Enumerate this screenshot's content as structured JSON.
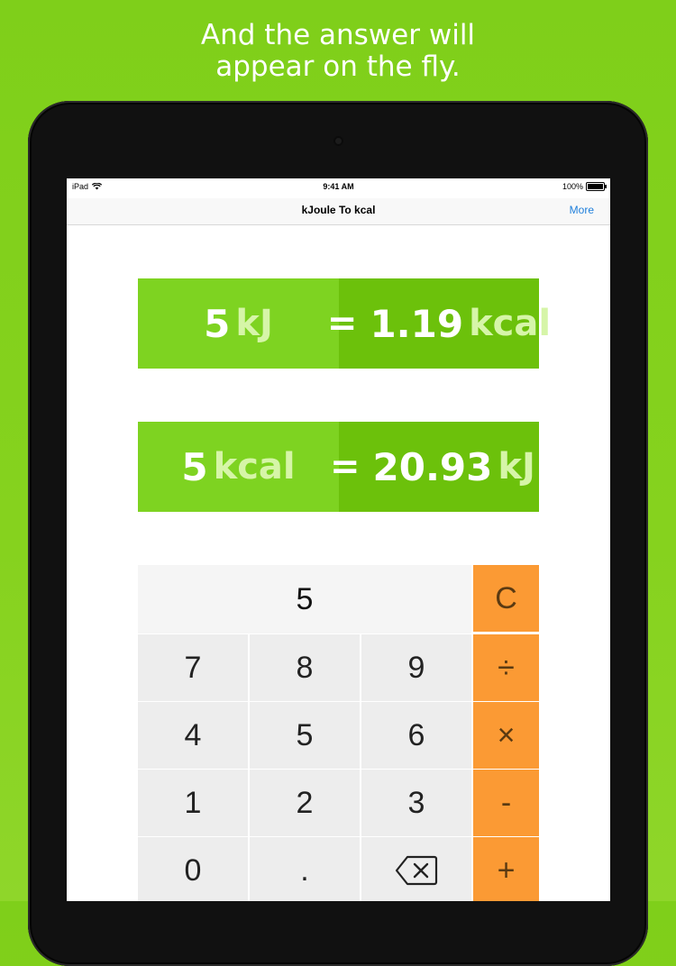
{
  "headline": {
    "line1": "And the answer will",
    "line2": "appear on the fly."
  },
  "status_bar": {
    "device": "iPad",
    "time": "9:41 AM",
    "battery": "100%"
  },
  "nav": {
    "title": "kJoule To kcal",
    "more": "More"
  },
  "conversions": [
    {
      "input_value": "5",
      "input_unit": "kJ",
      "equals": "=",
      "result_value": "1.19",
      "result_unit": "kcal"
    },
    {
      "input_value": "5",
      "input_unit": "kcal",
      "equals": "=",
      "result_value": "20.93",
      "result_unit": "kJ"
    }
  ],
  "keypad": {
    "display_value": "5",
    "clear": "C",
    "row1": [
      "7",
      "8",
      "9"
    ],
    "row2": [
      "4",
      "5",
      "6"
    ],
    "row3": [
      "1",
      "2",
      "3"
    ],
    "row4": [
      "0",
      "."
    ],
    "divide": "÷",
    "multiply": "×",
    "subtract": "-",
    "add": "+",
    "backspace_icon": "backspace-icon"
  },
  "colors": {
    "background_green": "#7fcf1a",
    "panel_left_green": "#7ed321",
    "panel_right_green": "#6cc10b",
    "operator_orange": "#fb9a34",
    "link_blue": "#1f7fdb"
  }
}
